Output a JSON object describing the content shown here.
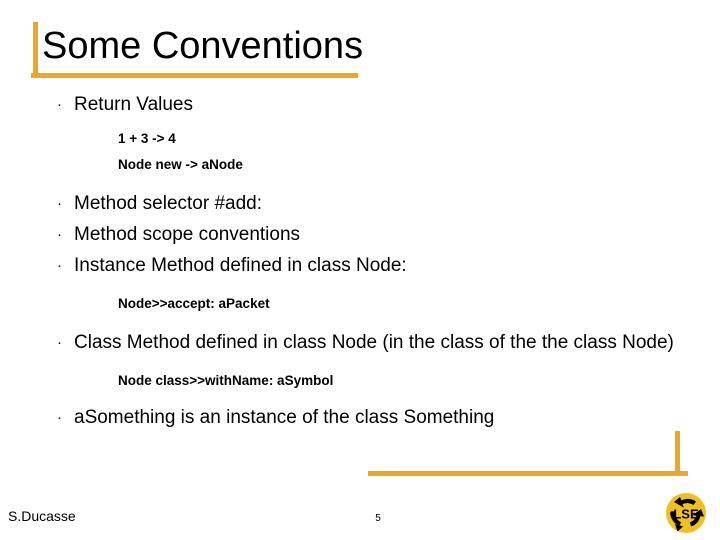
{
  "slide": {
    "title": "Some Conventions",
    "accent_color": "#e5a836",
    "text_color": "#000000",
    "background_color": "#ffffff",
    "content": [
      {
        "kind": "bullet",
        "bullet_glyph": "·",
        "text": "Return Values"
      },
      {
        "kind": "code",
        "text": "1 + 3 -> 4"
      },
      {
        "kind": "code",
        "text": "Node new -> aNode"
      },
      {
        "kind": "bullet",
        "bullet_glyph": "·",
        "text": "Method selector #add:"
      },
      {
        "kind": "bullet",
        "bullet_glyph": "·",
        "text": "Method scope conventions"
      },
      {
        "kind": "bullet",
        "bullet_glyph": "·",
        "text": "Instance Method defined in class Node:"
      },
      {
        "kind": "code",
        "text": "Node>>accept: aPacket"
      },
      {
        "kind": "bullet",
        "bullet_glyph": "·",
        "text": "Class Method defined in class Node (in the class of the the class Node)"
      },
      {
        "kind": "code",
        "text": "Node class>>withName: aSymbol"
      },
      {
        "kind": "bullet",
        "bullet_glyph": "·",
        "text": "aSomething is an instance of the class Something"
      }
    ]
  },
  "footer": {
    "author": "S.Ducasse",
    "page_number": "5",
    "logo_text": "LSE",
    "logo_color": "#f2c01e",
    "logo_arrow_color": "#000000"
  }
}
